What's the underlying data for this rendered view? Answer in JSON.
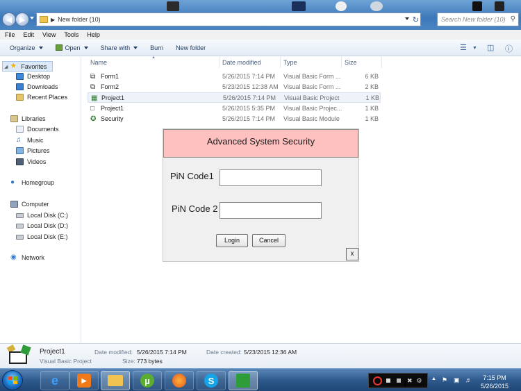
{
  "window": {
    "address_path": "New folder (10)",
    "search_placeholder": "Search New folder (10)"
  },
  "menu": [
    "File",
    "Edit",
    "View",
    "Tools",
    "Help"
  ],
  "toolbar": {
    "organize": "Organize",
    "open": "Open",
    "share_with": "Share with",
    "burn": "Burn",
    "new_folder": "New folder"
  },
  "nav": {
    "favorites": "Favorites",
    "desktop": "Desktop",
    "downloads": "Downloads",
    "recent_places": "Recent Places",
    "libraries": "Libraries",
    "documents": "Documents",
    "music": "Music",
    "pictures": "Pictures",
    "videos": "Videos",
    "homegroup": "Homegroup",
    "computer": "Computer",
    "disk_c": "Local Disk (C:)",
    "disk_d": "Local Disk (D:)",
    "disk_e": "Local Disk (E:)",
    "network": "Network"
  },
  "columns": {
    "name": "Name",
    "date": "Date modified",
    "type": "Type",
    "size": "Size"
  },
  "files": [
    {
      "name": "Form1",
      "date": "5/26/2015 7:14 PM",
      "type": "Visual Basic Form ...",
      "size": "6 KB",
      "icon": "vb-form-icon"
    },
    {
      "name": "Form2",
      "date": "5/23/2015 12:38 AM",
      "type": "Visual Basic Form ...",
      "size": "2 KB",
      "icon": "vb-form-icon"
    },
    {
      "name": "Project1",
      "date": "5/26/2015 7:14 PM",
      "type": "Visual Basic Project",
      "size": "1 KB",
      "icon": "vb-project-icon"
    },
    {
      "name": "Project1",
      "date": "5/26/2015 5:35 PM",
      "type": "Visual Basic Projec...",
      "size": "1 KB",
      "icon": "document-icon"
    },
    {
      "name": "Security",
      "date": "5/26/2015 7:14 PM",
      "type": "Visual Basic Module",
      "size": "1 KB",
      "icon": "vb-module-icon"
    }
  ],
  "dialog": {
    "title": "Advanced  System Security",
    "pin1_label": "PiN Code1",
    "pin2_label": "PiN Code 2",
    "pin1_value": "",
    "pin2_value": "",
    "login": "Login",
    "cancel": "Cancel",
    "close": "x",
    "title_bg": "#ffc0c0"
  },
  "details": {
    "name": "Project1",
    "type": "Visual Basic Project",
    "modified_label": "Date modified:",
    "modified_value": "5/26/2015 7:14 PM",
    "created_label": "Date created:",
    "created_value": "5/23/2015 12:36 AM",
    "size_label": "Size:",
    "size_value": "773 bytes"
  },
  "taskbar": {
    "time": "7:15 PM",
    "date": "5/26/2015"
  }
}
